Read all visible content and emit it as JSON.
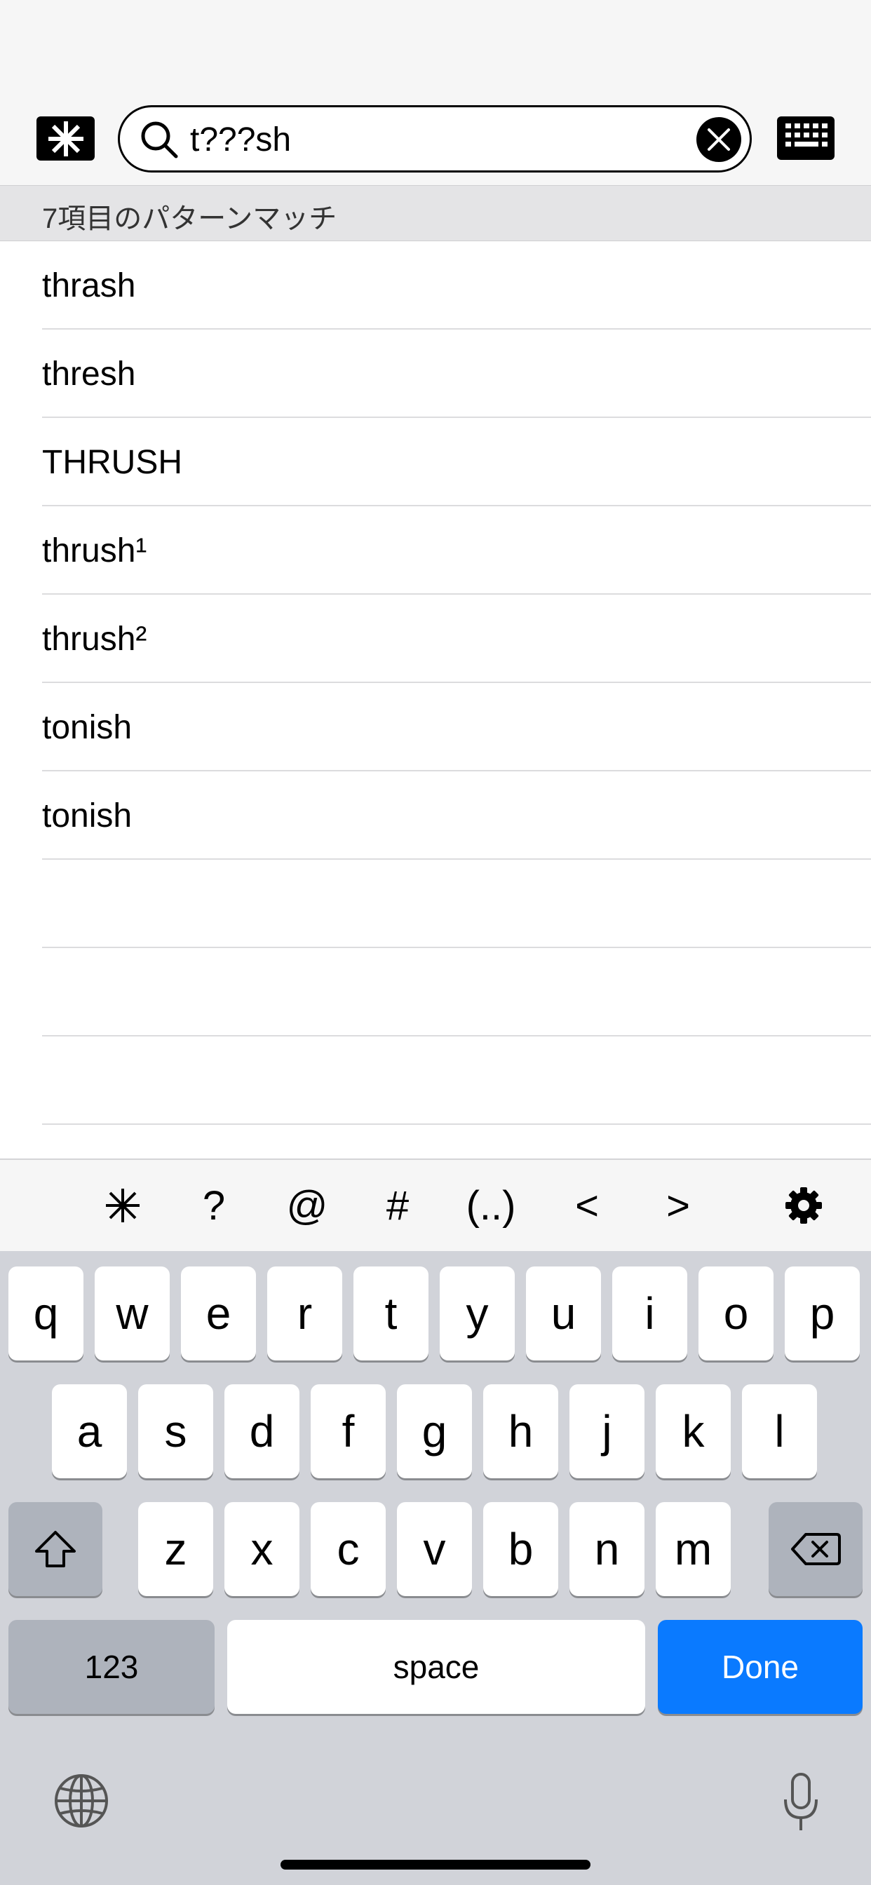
{
  "search": {
    "query": "t???sh"
  },
  "results_header": "7項目のパターンマッチ",
  "results": [
    {
      "word": "thrash"
    },
    {
      "word": "thresh"
    },
    {
      "word": "THRUSH"
    },
    {
      "word": "thrush¹"
    },
    {
      "word": "thrush²"
    },
    {
      "word": "tonish"
    },
    {
      "word": "tonish"
    }
  ],
  "accessory_bar": {
    "keys": [
      "*",
      "?",
      "@",
      "#",
      "(..)",
      "<",
      ">"
    ]
  },
  "keyboard": {
    "row1": [
      "q",
      "w",
      "e",
      "r",
      "t",
      "y",
      "u",
      "i",
      "o",
      "p"
    ],
    "row2": [
      "a",
      "s",
      "d",
      "f",
      "g",
      "h",
      "j",
      "k",
      "l"
    ],
    "row3": [
      "z",
      "x",
      "c",
      "v",
      "b",
      "n",
      "m"
    ],
    "numbers_label": "123",
    "space_label": "space",
    "done_label": "Done"
  },
  "icons": {
    "wildcard_button": "asterisk-icon",
    "search": "search-icon",
    "clear": "clear-icon",
    "keyboard_toggle": "keyboard-icon",
    "settings": "gear-icon",
    "shift": "shift-icon",
    "delete": "backspace-icon",
    "globe": "globe-icon",
    "mic": "microphone-icon"
  },
  "colors": {
    "done_button": "#0a7aff",
    "keyboard_bg": "#d1d3d9"
  }
}
